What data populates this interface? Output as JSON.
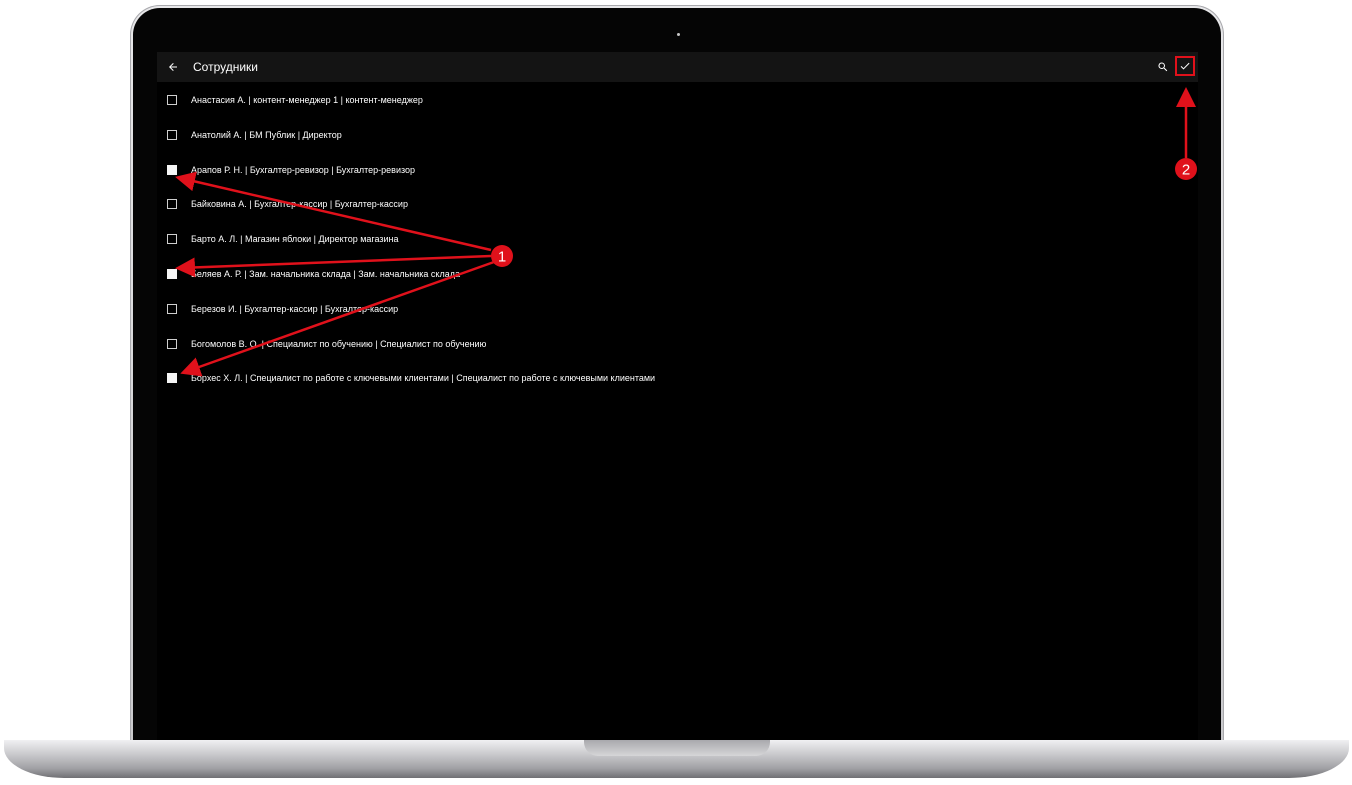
{
  "appbar": {
    "back_icon": "arrow-left-icon",
    "title": "Сотрудники",
    "search_icon": "search-icon",
    "confirm_icon": "check-icon"
  },
  "employees": [
    {
      "label": "Анастасия А. | контент-менеджер 1 | контент-менеджер",
      "checked": false
    },
    {
      "label": "Анатолий А. | БМ Публик | Директор",
      "checked": false
    },
    {
      "label": "Арапов Р. Н. | Бухгалтер-ревизор | Бухгалтер-ревизор",
      "checked": true
    },
    {
      "label": "Байковина А. | Бухгалтер-кассир | Бухгалтер-кассир",
      "checked": false
    },
    {
      "label": "Барто А. Л. | Магазин яблоки | Директор магазина",
      "checked": false
    },
    {
      "label": "Беляев А. Р. | Зам. начальника склада | Зам. начальника склада",
      "checked": true
    },
    {
      "label": "Березов И. | Бухгалтер-кассир | Бухгалтер-кассир",
      "checked": false
    },
    {
      "label": "Богомолов В. О. | Специалист по обучению | Специалист по обучению",
      "checked": false
    },
    {
      "label": "Борхес Х. Л. | Специалист по работе с ключевыми клиентами | Специалист по работе с ключевыми клиентами",
      "checked": true
    }
  ],
  "annotations": {
    "badge_1": "1",
    "badge_2": "2",
    "accent_color": "#e0111b"
  }
}
